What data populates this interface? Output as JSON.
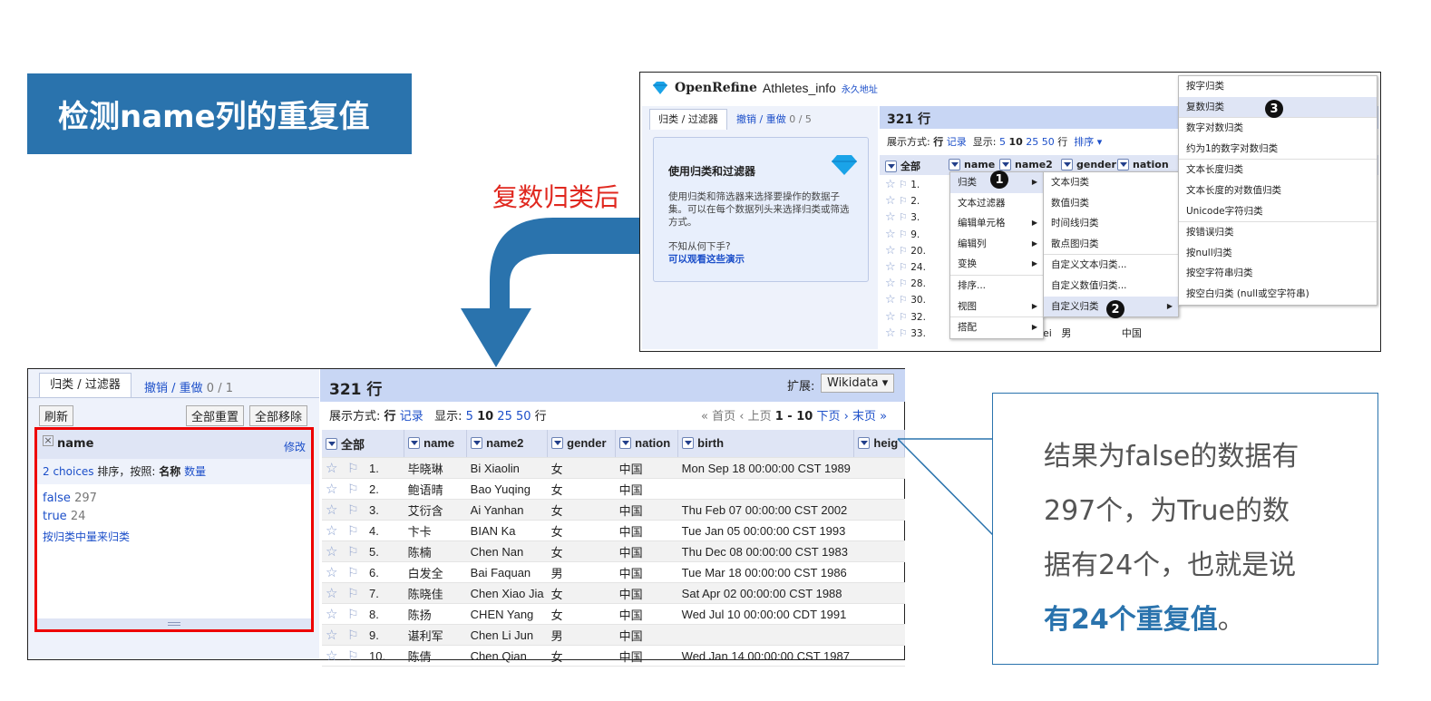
{
  "slide": {
    "title": "检测name列的重复值",
    "after_label": "复数归类后",
    "callout": {
      "lines": [
        "结果为false的数据有",
        "297个，为True的数",
        "据有24个，也就是说"
      ],
      "highlight": "有24个重复值",
      "tail": "。"
    }
  },
  "top_shot": {
    "logo": "OpenRefine",
    "project": "Athletes_info",
    "permalink": "永久地址",
    "tab_facets": "归类 / 过滤器",
    "undo": "撤销 / 重做",
    "undo_count": "0 / 5",
    "panel_title": "使用归类和过滤器",
    "panel_body": "使用归类和筛选器来选择要操作的数据子集。可以在每个数据列头来选择归类或筛选方式。",
    "panel_q": "不知从何下手?",
    "panel_link": "可以观看这些演示",
    "row_count": "321 行",
    "show_as": "展示方式:",
    "rows": "行",
    "records": "记录",
    "show": "显示:",
    "page_sizes": [
      "5",
      "10",
      "25",
      "50"
    ],
    "rows2": "行",
    "sort": "排序",
    "cols": [
      "全部",
      "name",
      "name2",
      "gender",
      "nation"
    ],
    "row_nums": [
      "1.",
      "2.",
      "3.",
      "9.",
      "20.",
      "24.",
      "28.",
      "30.",
      "32.",
      "33."
    ],
    "cell_fragment": [
      "ei",
      "男",
      "中国"
    ],
    "menu1": [
      "归类",
      "文本过滤器",
      "编辑单元格",
      "编辑列",
      "变换",
      "排序...",
      "视图",
      "搭配"
    ],
    "menu2": [
      "文本归类",
      "数值归类",
      "时间线归类",
      "散点图归类",
      "自定义文本归类...",
      "自定义数值归类...",
      "自定义归类"
    ],
    "menu3": [
      "按字归类",
      "复数归类",
      "数字对数归类",
      "约为1的数字对数归类",
      "文本长度归类",
      "文本长度的对数值归类",
      "Unicode字符归类",
      "按错误归类",
      "按null归类",
      "按空字符串归类",
      "按空白归类 (null或空字符串)"
    ],
    "badges": [
      "1",
      "2",
      "3"
    ]
  },
  "bottom_shot": {
    "tab_facets": "归类 / 过滤器",
    "undo": "撤销 / 重做",
    "undo_count": "0 / 1",
    "refresh": "刷新",
    "reset_all": "全部重置",
    "remove_all": "全部移除",
    "facet": {
      "close": "×",
      "name": "name",
      "edit": "修改",
      "choices": "2 choices",
      "sort_by": "排序，按照:",
      "sort_name": "名称",
      "sort_count": "数量",
      "items": [
        {
          "label": "false",
          "count": "297"
        },
        {
          "label": "true",
          "count": "24"
        }
      ],
      "cluster": "按归类中量来归类"
    },
    "row_count": "321 行",
    "extend": "扩展:",
    "wikidata": "Wikidata",
    "show_as": "展示方式:",
    "rows": "行",
    "records": "记录",
    "show": "显示:",
    "page_sizes": [
      "5",
      "10",
      "25",
      "50"
    ],
    "rows2": "行",
    "pager": {
      "first": "« 首页",
      "prev": "‹ 上页",
      "range": "1 - 10",
      "next": "下页 ›",
      "last": "末页 »"
    },
    "columns": [
      "全部",
      "name",
      "name2",
      "gender",
      "nation",
      "birth",
      "heig"
    ],
    "table": [
      [
        "1.",
        "毕晓琳",
        "Bi Xiaolin",
        "女",
        "中国",
        "Mon Sep 18 00:00:00 CST 1989"
      ],
      [
        "2.",
        "鲍语晴",
        "Bao Yuqing",
        "女",
        "中国",
        ""
      ],
      [
        "3.",
        "艾衍含",
        "Ai Yanhan",
        "女",
        "中国",
        "Thu Feb 07 00:00:00 CST 2002"
      ],
      [
        "4.",
        "卞卡",
        "BIAN Ka",
        "女",
        "中国",
        "Tue Jan 05 00:00:00 CST 1993"
      ],
      [
        "5.",
        "陈楠",
        "Chen Nan",
        "女",
        "中国",
        "Thu Dec 08 00:00:00 CST 1983"
      ],
      [
        "6.",
        "白发全",
        "Bai Faquan",
        "男",
        "中国",
        "Tue Mar 18 00:00:00 CST 1986"
      ],
      [
        "7.",
        "陈晓佳",
        "Chen Xiao Jia",
        "女",
        "中国",
        "Sat Apr 02 00:00:00 CST 1988"
      ],
      [
        "8.",
        "陈扬",
        "CHEN Yang",
        "女",
        "中国",
        "Wed Jul 10 00:00:00 CDT 1991"
      ],
      [
        "9.",
        "谌利军",
        "Chen Li Jun",
        "男",
        "中国",
        ""
      ],
      [
        "10.",
        "陈倩",
        "Chen Qian",
        "女",
        "中国",
        "Wed Jan 14 00:00:00 CST 1987"
      ]
    ]
  },
  "colors": {
    "accent": "#2a73ad",
    "red": "#e0281f",
    "link": "#1c4fc9"
  }
}
